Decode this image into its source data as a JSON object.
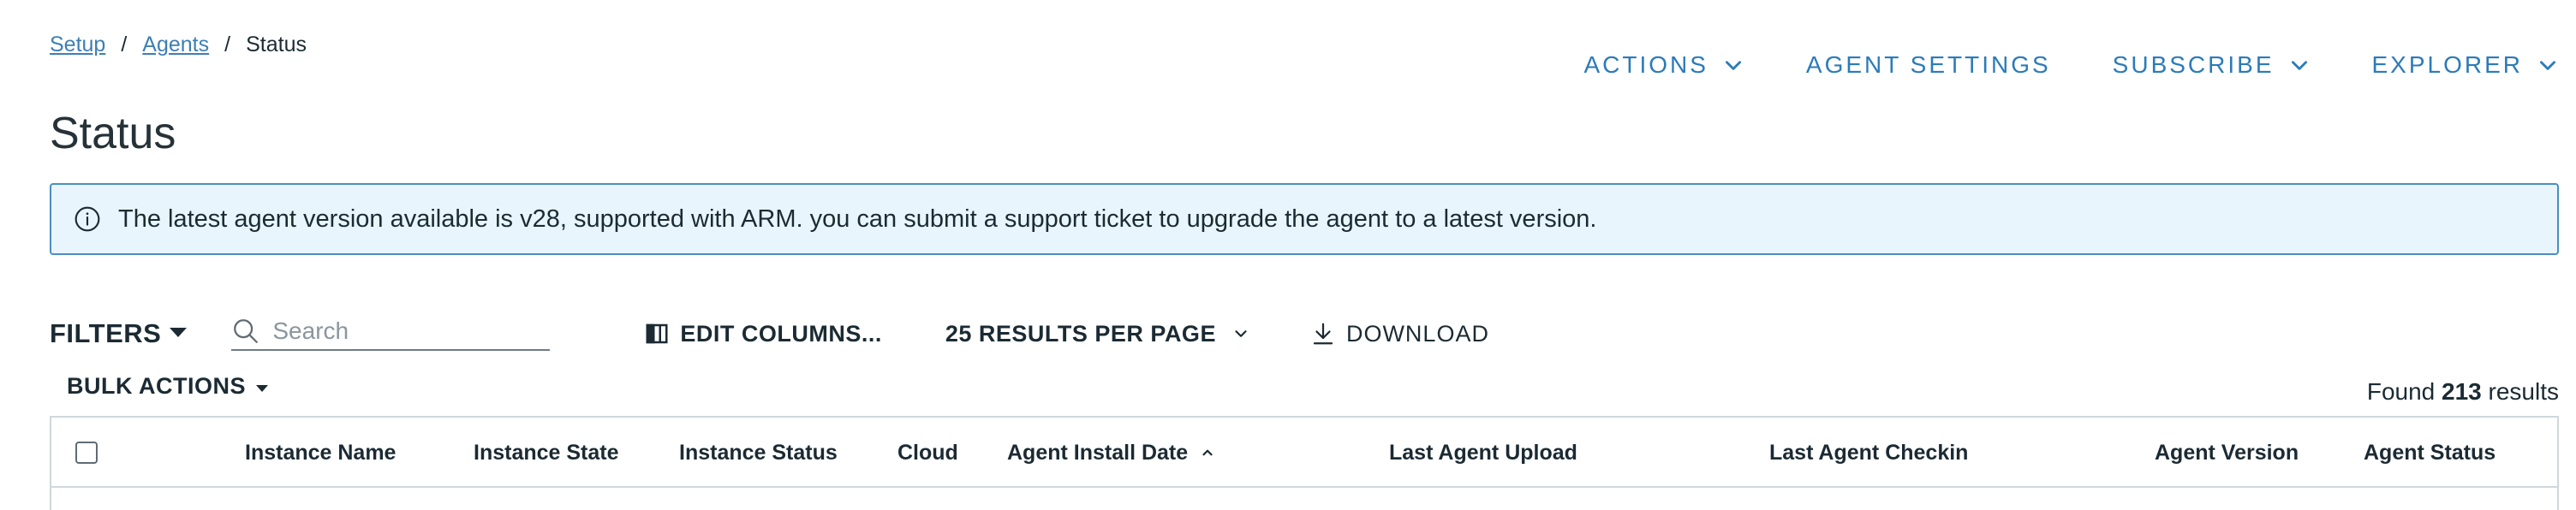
{
  "breadcrumb": {
    "items": [
      {
        "label": "Setup",
        "link": true
      },
      {
        "label": "Agents",
        "link": true
      },
      {
        "label": "Status",
        "link": false
      }
    ],
    "separator": "/"
  },
  "page_title": "Status",
  "header_actions": {
    "actions": "ACTIONS",
    "agent_settings": "AGENT SETTINGS",
    "subscribe": "SUBSCRIBE",
    "explorer": "EXPLORER"
  },
  "alert": {
    "message": "The latest agent version available is v28, supported with ARM. you can submit a support ticket to upgrade the agent to a latest version.",
    "icon": "info-icon"
  },
  "toolbar": {
    "filters_label": "FILTERS",
    "search_placeholder": "Search",
    "search_value": "",
    "edit_columns_label": "EDIT COLUMNS...",
    "results_per_page_label": "25 RESULTS PER PAGE",
    "download_label": "DOWNLOAD"
  },
  "bulk_actions_label": "BULK ACTIONS",
  "results": {
    "prefix": "Found",
    "count": "213",
    "suffix": "results"
  },
  "table": {
    "columns": [
      "Instance Name",
      "Instance State",
      "Instance Status",
      "Cloud",
      "Agent Install Date",
      "Last Agent Upload",
      "Last Agent Checkin",
      "Agent Version",
      "Agent Status"
    ],
    "sorted_column": "Agent Install Date",
    "sort_direction": "ascending"
  },
  "colors": {
    "link": "#3d7fb4",
    "accent": "#2b7bb9",
    "alert_bg": "#e8f5fc",
    "alert_border": "#4a8fbf",
    "text": "#1b2a33"
  }
}
